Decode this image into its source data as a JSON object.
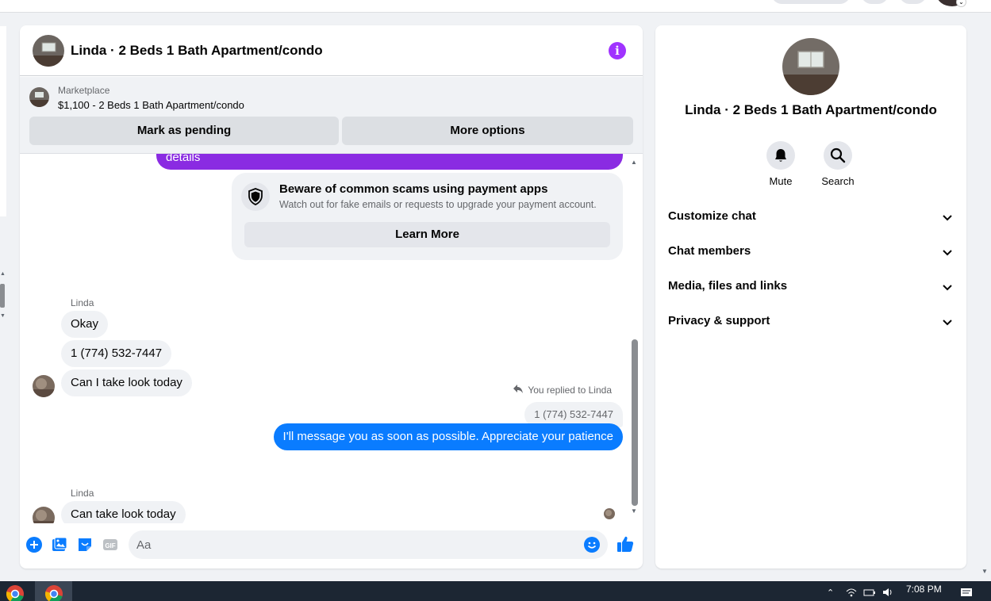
{
  "chat": {
    "title": "Linda · 2 Beds 1 Bath Apartment/condo",
    "marketplace": {
      "label": "Marketplace",
      "listing": "$1,100 - 2 Beds 1 Bath Apartment/condo",
      "pending_button": "Mark as pending",
      "more_button": "More options"
    },
    "previous_bubble_tail": "details",
    "scam_notice": {
      "title": "Beware of common scams using payment apps",
      "subtitle": "Watch out for fake emails or requests to upgrade your payment account.",
      "button": "Learn More"
    },
    "messages": [
      {
        "sender": "Linda",
        "texts": [
          "Okay",
          "1 (774) 532-7447",
          "Can I take look today"
        ]
      },
      {
        "replied_label": "You replied to Linda",
        "quoted": "1 (774) 532-7447",
        "text": "I'll message you as soon as possible. Appreciate your patience"
      },
      {
        "sender": "Linda",
        "texts": [
          "Can take look today"
        ]
      }
    ],
    "composer": {
      "placeholder": "Aa"
    }
  },
  "details": {
    "title": "Linda · 2 Beds 1 Bath Apartment/condo",
    "actions": [
      {
        "label": "Mute",
        "icon": "bell-icon"
      },
      {
        "label": "Search",
        "icon": "search-icon"
      }
    ],
    "sections": [
      "Customize chat",
      "Chat members",
      "Media, files and links",
      "Privacy & support"
    ]
  },
  "taskbar": {
    "time": "7:08 PM"
  },
  "colors": {
    "accent": "#0a7cff",
    "purple": "#8a2be2",
    "info": "#a033ff"
  }
}
